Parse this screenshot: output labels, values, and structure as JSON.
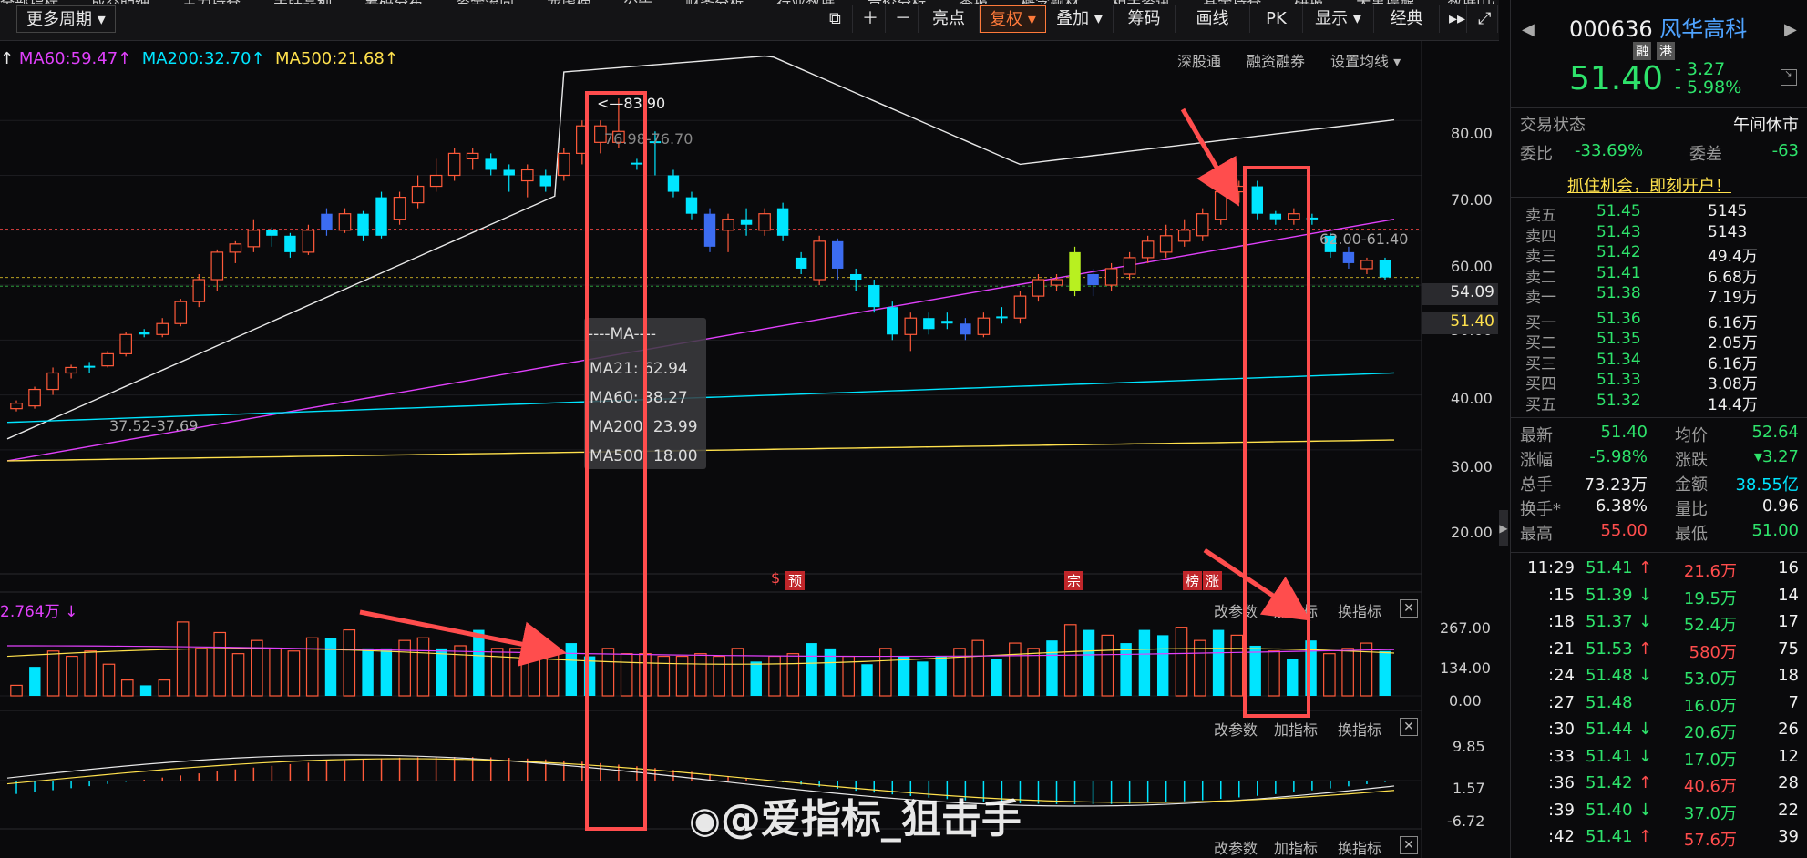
{
  "toolbar": {
    "top_cut_labels": [
      "全部指标",
      "成交明细",
      "主力持仓",
      "关联品种",
      "筹码分布",
      "资金流向",
      "龙虎榜",
      "公告",
      "财务分析",
      "行业数据",
      "竞价分析",
      "季报",
      "概念题材",
      "相关资讯",
      "基金持仓",
      "研报",
      "大事提醒",
      "数据中心"
    ],
    "more_period": "更多周期",
    "buttons": [
      "亮点",
      "复权",
      "叠加",
      "筹码",
      "画线",
      "PK",
      "显示",
      "经典"
    ],
    "active_button": "复权"
  },
  "ma_legend": {
    "ma60": "MA60:59.47",
    "ma200": "MA200:32.70",
    "ma500": "MA500:21.68",
    "arrow": "↑",
    "colors": {
      "ma60": "#e040fb",
      "ma200": "#00e5ff",
      "ma500": "#ffe14d",
      "ma21": "#e8e8e8"
    }
  },
  "chart_links": [
    "深股通",
    "融资融券",
    "设置均线"
  ],
  "price_axis": [
    "80.00",
    "70.00",
    "60.00",
    "50.00",
    "40.00",
    "30.00",
    "20.00"
  ],
  "price_tags": {
    "ma_tag": "54.09",
    "last_tag": "51.40"
  },
  "annotations": {
    "high": "83.90",
    "high_range": "76.98-76.70",
    "low_range": "37.52-37.69",
    "right_range": "62.00-61.40"
  },
  "ma_tooltip": {
    "title": "----MA----",
    "lines": [
      "MA21: 62.94",
      "MA60: 38.27",
      "MA200: 23.99",
      "MA500: 18.00"
    ]
  },
  "event_badges": [
    "预",
    "宗",
    "榜",
    "涨"
  ],
  "volume_panel": {
    "label": "2.764万",
    "axis": [
      "267.00",
      "134.00",
      "0.00"
    ],
    "links": [
      "改参数",
      "加指标",
      "换指标"
    ]
  },
  "macd_panel": {
    "axis": [
      "9.85",
      "1.57",
      "-6.72"
    ],
    "links": [
      "改参数",
      "加指标",
      "换指标"
    ]
  },
  "bottom_links": [
    "改参数",
    "加指标",
    "换指标"
  ],
  "watermark": "@爱指标_狙击手",
  "chart_data": {
    "type": "candlestick",
    "ylim": [
      15,
      88
    ],
    "candles": [
      {
        "o": 27.5,
        "c": 28.5,
        "h": 29,
        "l": 27,
        "up": true
      },
      {
        "o": 28,
        "c": 31,
        "h": 31.5,
        "l": 27.5,
        "up": true
      },
      {
        "o": 31,
        "c": 34,
        "h": 35,
        "l": 30,
        "up": true
      },
      {
        "o": 34,
        "c": 35,
        "h": 35.5,
        "l": 33,
        "up": true
      },
      {
        "o": 35,
        "c": 35.3,
        "h": 36,
        "l": 34,
        "up": false
      },
      {
        "o": 35.3,
        "c": 37.5,
        "h": 38,
        "l": 35,
        "up": true
      },
      {
        "o": 37.5,
        "c": 41,
        "h": 41.5,
        "l": 37,
        "up": true
      },
      {
        "o": 41,
        "c": 41.5,
        "h": 42,
        "l": 40.5,
        "up": false
      },
      {
        "o": 41,
        "c": 43,
        "h": 44,
        "l": 40.5,
        "up": true
      },
      {
        "o": 43,
        "c": 47,
        "h": 47.5,
        "l": 42.5,
        "up": true
      },
      {
        "o": 47,
        "c": 51,
        "h": 52,
        "l": 46,
        "up": true
      },
      {
        "o": 51,
        "c": 56,
        "h": 56.5,
        "l": 49,
        "up": true
      },
      {
        "o": 56,
        "c": 57.5,
        "h": 58,
        "l": 54,
        "up": true
      },
      {
        "o": 57,
        "c": 60,
        "h": 62,
        "l": 56,
        "up": true
      },
      {
        "o": 60,
        "c": 59,
        "h": 60.5,
        "l": 57,
        "up": false
      },
      {
        "o": 59,
        "c": 56,
        "h": 59.5,
        "l": 55,
        "up": false
      },
      {
        "o": 56,
        "c": 60,
        "h": 61,
        "l": 55.5,
        "up": true
      },
      {
        "o": 60,
        "c": 63,
        "h": 64,
        "l": 59,
        "up": false
      },
      {
        "o": 60,
        "c": 63,
        "h": 64,
        "l": 59.5,
        "up": true
      },
      {
        "o": 63,
        "c": 59,
        "h": 63.5,
        "l": 58,
        "up": false
      },
      {
        "o": 59,
        "c": 66,
        "h": 67,
        "l": 58.5,
        "up": false
      },
      {
        "o": 62,
        "c": 66,
        "h": 67,
        "l": 61,
        "up": true
      },
      {
        "o": 65,
        "c": 68,
        "h": 70,
        "l": 64,
        "up": true
      },
      {
        "o": 68,
        "c": 70,
        "h": 73,
        "l": 67,
        "up": true
      },
      {
        "o": 70,
        "c": 74,
        "h": 75,
        "l": 69,
        "up": true
      },
      {
        "o": 74,
        "c": 73,
        "h": 75,
        "l": 71,
        "up": true
      },
      {
        "o": 73,
        "c": 71,
        "h": 74,
        "l": 70,
        "up": false
      },
      {
        "o": 71,
        "c": 70,
        "h": 72,
        "l": 67,
        "up": false
      },
      {
        "o": 69,
        "c": 71,
        "h": 72,
        "l": 66,
        "up": true
      },
      {
        "o": 70,
        "c": 68,
        "h": 71,
        "l": 67,
        "up": false
      },
      {
        "o": 70,
        "c": 74,
        "h": 75,
        "l": 69,
        "up": true
      },
      {
        "o": 74,
        "c": 79,
        "h": 80,
        "l": 72,
        "up": true
      },
      {
        "o": 76,
        "c": 79,
        "h": 80,
        "l": 74,
        "up": true
      },
      {
        "o": 78,
        "c": 76,
        "h": 84,
        "l": 75,
        "up": true
      },
      {
        "o": 72,
        "c": 72.3,
        "h": 73,
        "l": 71,
        "up": false
      },
      {
        "o": 76,
        "c": 76.2,
        "h": 78,
        "l": 70,
        "up": false
      },
      {
        "o": 70,
        "c": 67,
        "h": 71,
        "l": 66,
        "up": false
      },
      {
        "o": 66,
        "c": 63,
        "h": 67,
        "l": 62,
        "up": false
      },
      {
        "o": 63,
        "c": 57,
        "h": 64,
        "l": 56,
        "up": false
      },
      {
        "o": 60,
        "c": 62,
        "h": 63,
        "l": 56,
        "up": true
      },
      {
        "o": 62,
        "c": 61,
        "h": 64,
        "l": 59,
        "up": false
      },
      {
        "o": 60,
        "c": 63,
        "h": 64,
        "l": 59,
        "up": true
      },
      {
        "o": 64,
        "c": 59,
        "h": 65,
        "l": 58,
        "up": false
      },
      {
        "o": 55,
        "c": 53,
        "h": 56,
        "l": 52,
        "up": false
      },
      {
        "o": 51,
        "c": 58,
        "h": 59,
        "l": 50,
        "up": true
      },
      {
        "o": 58,
        "c": 53,
        "h": 58.5,
        "l": 51,
        "up": false
      },
      {
        "o": 52,
        "c": 51,
        "h": 53,
        "l": 49,
        "up": false
      },
      {
        "o": 50,
        "c": 46,
        "h": 51,
        "l": 45,
        "up": false
      },
      {
        "o": 46,
        "c": 41,
        "h": 47,
        "l": 40,
        "up": false
      },
      {
        "o": 41,
        "c": 44,
        "h": 45,
        "l": 38,
        "up": true
      },
      {
        "o": 44,
        "c": 42,
        "h": 45,
        "l": 41,
        "up": false
      },
      {
        "o": 43,
        "c": 43.5,
        "h": 45,
        "l": 42,
        "up": false
      },
      {
        "o": 43,
        "c": 41,
        "h": 44,
        "l": 40,
        "up": false
      },
      {
        "o": 41,
        "c": 44,
        "h": 45,
        "l": 40.5,
        "up": true
      },
      {
        "o": 44,
        "c": 44.3,
        "h": 46,
        "l": 43,
        "up": false
      },
      {
        "o": 44,
        "c": 48,
        "h": 49,
        "l": 43,
        "up": true
      },
      {
        "o": 48,
        "c": 51,
        "h": 52,
        "l": 47,
        "up": true
      },
      {
        "o": 50,
        "c": 51,
        "h": 52,
        "l": 49,
        "up": true
      },
      {
        "o": 49,
        "c": 56,
        "h": 57,
        "l": 48,
        "up": true,
        "lime": true
      },
      {
        "o": 52,
        "c": 50,
        "h": 53,
        "l": 48,
        "up": false
      },
      {
        "o": 50,
        "c": 53,
        "h": 54,
        "l": 49,
        "up": true
      },
      {
        "o": 52,
        "c": 55,
        "h": 56,
        "l": 51,
        "up": true
      },
      {
        "o": 55,
        "c": 58,
        "h": 59,
        "l": 54,
        "up": true
      },
      {
        "o": 56,
        "c": 59,
        "h": 61,
        "l": 55,
        "up": true
      },
      {
        "o": 58,
        "c": 60,
        "h": 62,
        "l": 57,
        "up": true
      },
      {
        "o": 59,
        "c": 63,
        "h": 64,
        "l": 58,
        "up": true
      },
      {
        "o": 62,
        "c": 67,
        "h": 69,
        "l": 61,
        "up": true
      },
      {
        "o": 67,
        "c": 68,
        "h": 69,
        "l": 65,
        "up": true
      },
      {
        "o": 68,
        "c": 63,
        "h": 69,
        "l": 62,
        "up": false
      },
      {
        "o": 63,
        "c": 62,
        "h": 63.5,
        "l": 61,
        "up": false
      },
      {
        "o": 62,
        "c": 63,
        "h": 64,
        "l": 61,
        "up": true
      },
      {
        "o": 62,
        "c": 62.3,
        "h": 63,
        "l": 61,
        "up": false
      },
      {
        "o": 59,
        "c": 56,
        "h": 59.5,
        "l": 55,
        "up": false
      },
      {
        "o": 56,
        "c": 54,
        "h": 57,
        "l": 53,
        "up": false
      },
      {
        "o": 53,
        "c": 54.5,
        "h": 55,
        "l": 52,
        "up": true
      },
      {
        "o": 54.5,
        "c": 51.4,
        "h": 55,
        "l": 51,
        "up": false
      }
    ],
    "volumes": [
      [
        40,
        1
      ],
      [
        110,
        0
      ],
      [
        170,
        1
      ],
      [
        150,
        1
      ],
      [
        170,
        1
      ],
      [
        120,
        1
      ],
      [
        60,
        1
      ],
      [
        40,
        0
      ],
      [
        60,
        1
      ],
      [
        280,
        1
      ],
      [
        180,
        1
      ],
      [
        240,
        1
      ],
      [
        160,
        1
      ],
      [
        210,
        1
      ],
      [
        180,
        1
      ],
      [
        170,
        1
      ],
      [
        220,
        1
      ],
      [
        220,
        0
      ],
      [
        250,
        1
      ],
      [
        180,
        0
      ],
      [
        180,
        0
      ],
      [
        210,
        1
      ],
      [
        220,
        1
      ],
      [
        180,
        0
      ],
      [
        190,
        1
      ],
      [
        250,
        0
      ],
      [
        180,
        1
      ],
      [
        180,
        1
      ],
      [
        180,
        1
      ],
      [
        180,
        1
      ],
      [
        200,
        0
      ],
      [
        150,
        0
      ],
      [
        180,
        1
      ],
      [
        160,
        1
      ],
      [
        160,
        1
      ],
      [
        150,
        1
      ],
      [
        150,
        1
      ],
      [
        160,
        1
      ],
      [
        150,
        1
      ],
      [
        180,
        1
      ],
      [
        130,
        0
      ],
      [
        150,
        1
      ],
      [
        160,
        1
      ],
      [
        200,
        0
      ],
      [
        180,
        0
      ],
      [
        150,
        1
      ],
      [
        120,
        0
      ],
      [
        180,
        1
      ],
      [
        150,
        0
      ],
      [
        130,
        0
      ],
      [
        150,
        0
      ],
      [
        180,
        1
      ],
      [
        210,
        1
      ],
      [
        140,
        0
      ],
      [
        200,
        1
      ],
      [
        180,
        1
      ],
      [
        210,
        0
      ],
      [
        270,
        1
      ],
      [
        250,
        0
      ],
      [
        230,
        1
      ],
      [
        200,
        0
      ],
      [
        250,
        0
      ],
      [
        230,
        0
      ],
      [
        260,
        1
      ],
      [
        210,
        1
      ],
      [
        250,
        0
      ],
      [
        230,
        1
      ],
      [
        190,
        0
      ],
      [
        170,
        1
      ],
      [
        140,
        0
      ],
      [
        210,
        0
      ],
      [
        160,
        1
      ],
      [
        180,
        1
      ],
      [
        200,
        1
      ],
      [
        170,
        0
      ]
    ]
  },
  "sidebar": {
    "code": "000636",
    "name": "风华高科",
    "badges": [
      "融",
      "港"
    ],
    "price": "51.40",
    "change": "- 3.27",
    "change_pct": "- 5.98%",
    "trade_status_label": "交易状态",
    "trade_status": "午间休市",
    "weibi_label": "委比",
    "weibi": "-33.69%",
    "weicha_label": "委差",
    "weicha": "-63",
    "promo": "抓住机会，即刻开户！",
    "sells": [
      {
        "label": "卖五",
        "price": "51.45",
        "vol": "5145"
      },
      {
        "label": "卖四",
        "price": "51.43",
        "vol": "5143"
      },
      {
        "label": "卖三",
        "price": "51.42",
        "vol": "49.4万"
      },
      {
        "label": "卖二",
        "price": "51.41",
        "vol": "6.68万"
      },
      {
        "label": "卖一",
        "price": "51.38",
        "vol": "7.19万"
      }
    ],
    "buys": [
      {
        "label": "买一",
        "price": "51.36",
        "vol": "6.16万"
      },
      {
        "label": "买二",
        "price": "51.35",
        "vol": "2.05万"
      },
      {
        "label": "买三",
        "price": "51.34",
        "vol": "6.16万"
      },
      {
        "label": "买四",
        "price": "51.33",
        "vol": "3.08万"
      },
      {
        "label": "买五",
        "price": "51.32",
        "vol": "14.4万"
      }
    ],
    "stats": [
      {
        "k1": "最新",
        "v1": "51.40",
        "c1": "green",
        "k2": "均价",
        "v2": "52.64",
        "c2": "green"
      },
      {
        "k1": "涨幅",
        "v1": "-5.98%",
        "c1": "green",
        "k2": "涨跌",
        "v2": "▾3.27",
        "c2": "green"
      },
      {
        "k1": "总手",
        "v1": "73.23万",
        "c1": "white",
        "k2": "金额",
        "v2": "38.55亿",
        "c2": "cyan"
      },
      {
        "k1": "换手*",
        "v1": "6.38%",
        "c1": "white",
        "k2": "量比",
        "v2": "0.96",
        "c2": "white"
      },
      {
        "k1": "最高",
        "v1": "55.00",
        "c1": "red",
        "k2": "最低",
        "v2": "51.00",
        "c2": "green"
      }
    ],
    "ticks": [
      {
        "t": "11:29",
        "p": "51.41",
        "d": "↑",
        "v": "21.6万",
        "n": "16"
      },
      {
        "t": ":15",
        "p": "51.39",
        "d": "↓",
        "v": "19.5万",
        "n": "14"
      },
      {
        "t": ":18",
        "p": "51.37",
        "d": "↓",
        "v": "52.4万",
        "n": "17"
      },
      {
        "t": ":21",
        "p": "51.53",
        "d": "↑",
        "v": "580万",
        "n": "75"
      },
      {
        "t": ":24",
        "p": "51.48",
        "d": "↓",
        "v": "53.0万",
        "n": "18"
      },
      {
        "t": ":27",
        "p": "51.48",
        "d": "",
        "v": "16.0万",
        "n": "7"
      },
      {
        "t": ":30",
        "p": "51.44",
        "d": "↓",
        "v": "20.6万",
        "n": "26"
      },
      {
        "t": ":33",
        "p": "51.41",
        "d": "↓",
        "v": "17.0万",
        "n": "12"
      },
      {
        "t": ":36",
        "p": "51.42",
        "d": "↑",
        "v": "40.6万",
        "n": "28"
      },
      {
        "t": ":39",
        "p": "51.40",
        "d": "↓",
        "v": "37.0万",
        "n": "22"
      },
      {
        "t": ":42",
        "p": "51.41",
        "d": "↑",
        "v": "57.6万",
        "n": "39"
      }
    ]
  }
}
